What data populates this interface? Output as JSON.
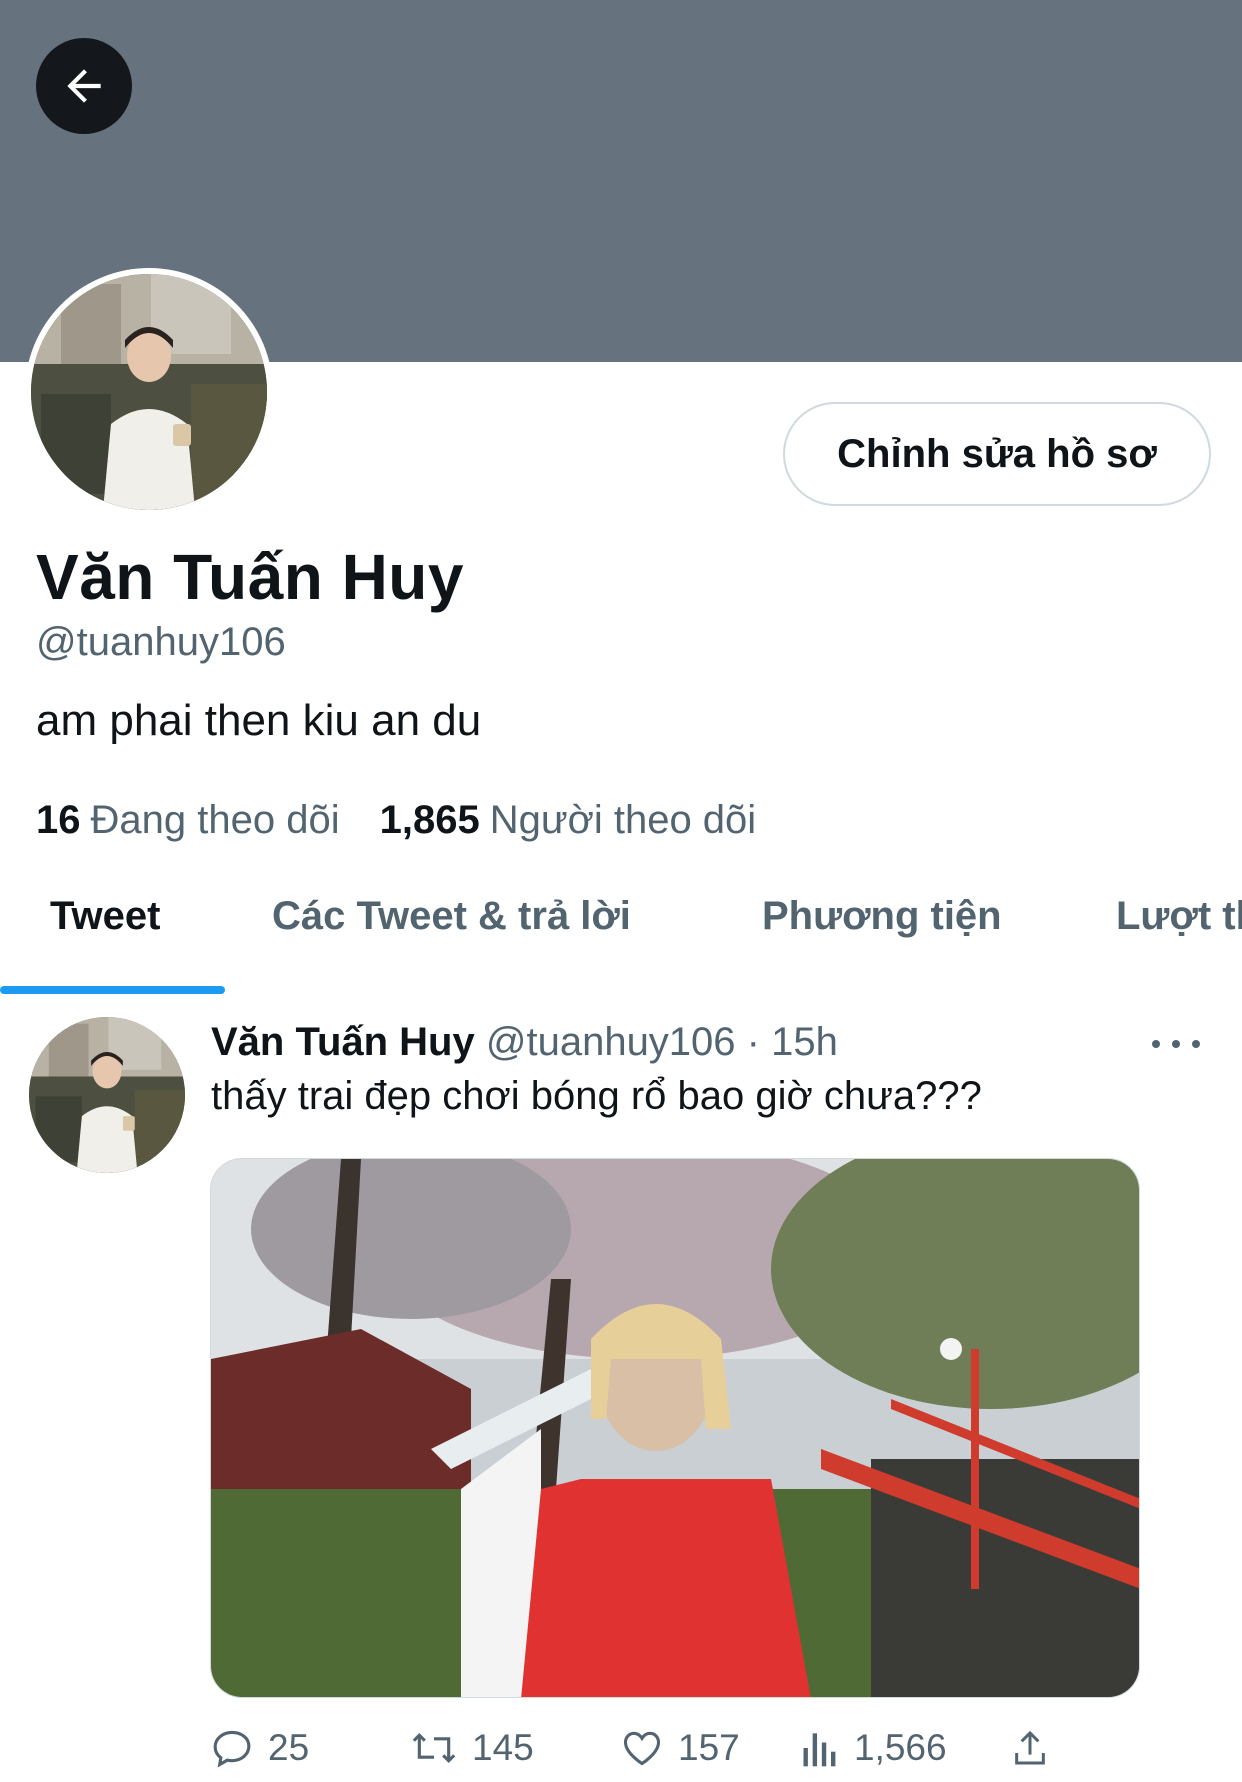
{
  "profile": {
    "name": "Văn Tuấn Huy",
    "handle": "@tuanhuy106",
    "bio": "am phai then kiu an du",
    "following_count": "16",
    "following_label": "Đang theo dõi",
    "followers_count": "1,865",
    "followers_label": "Người theo dõi",
    "edit_button": "Chỉnh sửa hồ sơ"
  },
  "tabs": [
    {
      "label": "Tweet",
      "active": true
    },
    {
      "label": "Các Tweet & trả lời",
      "active": false
    },
    {
      "label": "Phương tiện",
      "active": false
    },
    {
      "label": "Lượt thích",
      "active": false
    }
  ],
  "tweet": {
    "name": "Văn Tuấn Huy",
    "meta": "@tuanhuy106 · 15h",
    "text": "thấy trai đẹp chơi bóng rổ bao giờ chưa???",
    "replies": "25",
    "retweets": "145",
    "likes": "157",
    "views": "1,566"
  },
  "icons": {
    "back": "arrow-left-icon",
    "more": "more-horizontal-icon",
    "reply": "comment-icon",
    "retweet": "retweet-icon",
    "like": "heart-icon",
    "views": "analytics-icon",
    "share": "share-icon"
  },
  "colors": {
    "banner": "#66737f",
    "accent": "#1d9bf0",
    "secondary_text": "#536471",
    "primary_text": "#0f1419"
  }
}
